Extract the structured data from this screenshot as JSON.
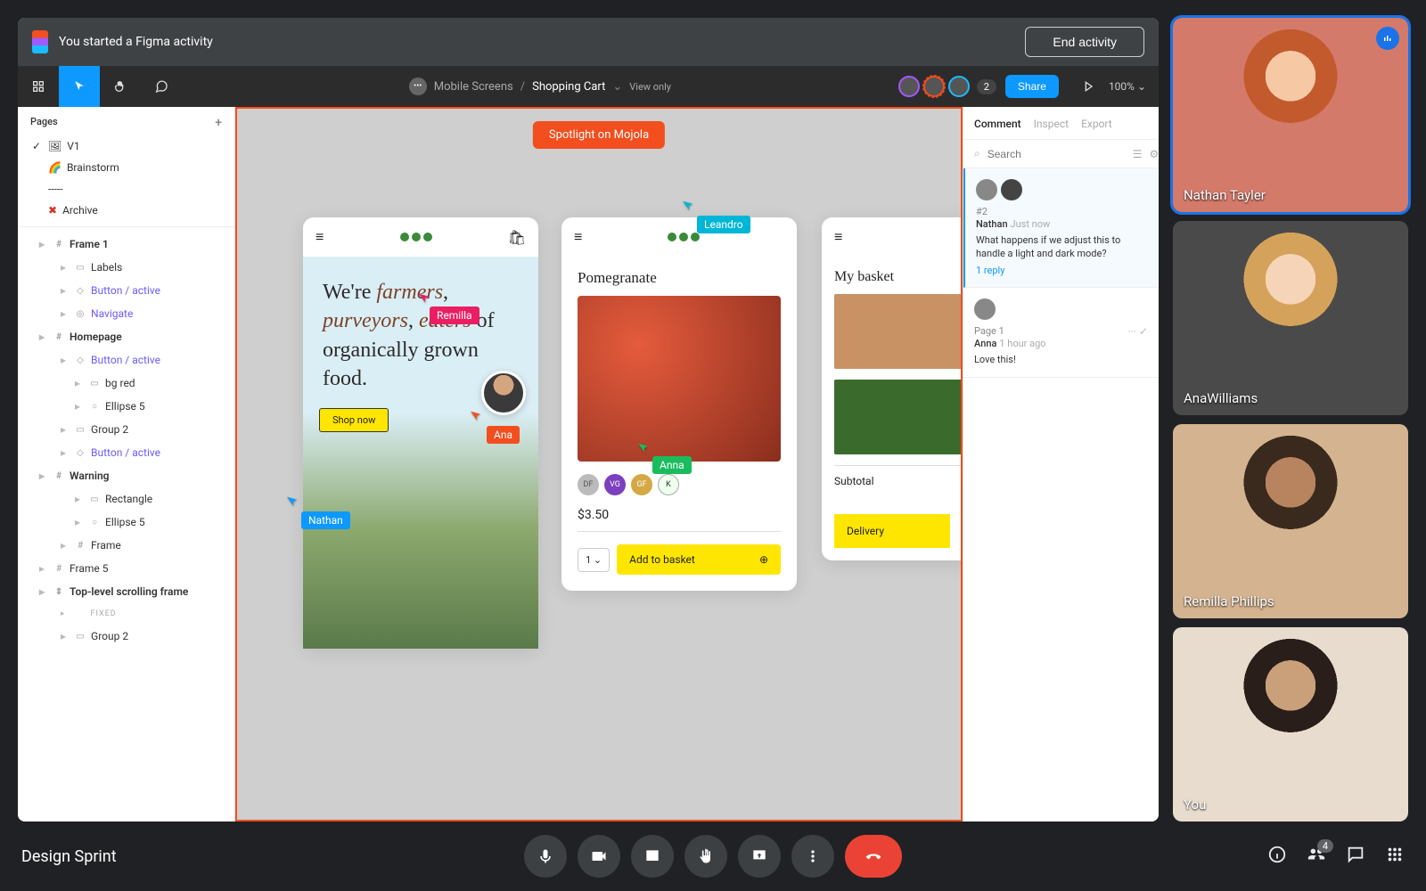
{
  "activity": {
    "title": "You started a Figma activity",
    "endLabel": "End activity"
  },
  "header": {
    "project": "Mobile Screens",
    "page": "Shopping Cart",
    "viewMode": "View only",
    "avatarCount": "2",
    "share": "Share",
    "zoom": "100%"
  },
  "pages": {
    "heading": "Pages",
    "items": [
      {
        "label": "V1",
        "prefix": "✓",
        "icon": "🖼"
      },
      {
        "label": "Brainstorm",
        "icon": "🌈"
      },
      {
        "label": "-----"
      },
      {
        "label": "Archive",
        "icon": "✖",
        "color": "#d93025"
      }
    ]
  },
  "layers": [
    {
      "label": "Frame 1",
      "level": 1,
      "icon": "#",
      "bold": true
    },
    {
      "label": "Labels",
      "level": 2,
      "icon": "▭"
    },
    {
      "label": "Button / active",
      "level": 2,
      "icon": "◇",
      "blue": true
    },
    {
      "label": "Navigate",
      "level": 2,
      "icon": "◎",
      "blue": true
    },
    {
      "label": "Homepage",
      "level": 1,
      "icon": "#",
      "bold": true
    },
    {
      "label": "Button / active",
      "level": 2,
      "icon": "◇",
      "blue": true
    },
    {
      "label": "bg red",
      "level": 3,
      "icon": "▭"
    },
    {
      "label": "Ellipse 5",
      "level": 3,
      "icon": "○"
    },
    {
      "label": "Group 2",
      "level": 2,
      "icon": "▭"
    },
    {
      "label": "Button / active",
      "level": 2,
      "icon": "◇",
      "blue": true
    },
    {
      "label": "Warning",
      "level": 1,
      "icon": "#",
      "bold": true
    },
    {
      "label": "Rectangle",
      "level": 3,
      "icon": "▭"
    },
    {
      "label": "Ellipse 5",
      "level": 3,
      "icon": "○"
    },
    {
      "label": "Frame",
      "level": 2,
      "icon": "#"
    },
    {
      "label": "Frame 5",
      "level": 1,
      "icon": "#"
    },
    {
      "label": "Top-level scrolling frame",
      "level": 1,
      "icon": "⇕",
      "bold": true
    },
    {
      "label": "FIXED",
      "level": 2,
      "gray": true
    },
    {
      "label": "Group 2",
      "level": 2,
      "icon": "▭"
    }
  ],
  "canvas": {
    "spotlight": "Spotlight on Mojola",
    "mock1": {
      "heroHtml": "We're <i>farmers</i>, <i>purveyors</i>, <i>eaters</i> of organically grown food.",
      "cta": "Shop now"
    },
    "mock2": {
      "title": "Pomegranate",
      "chips": [
        "DF",
        "VG",
        "GF",
        "K"
      ],
      "price": "$3.50",
      "qty": "1",
      "add": "Add to basket"
    },
    "mock3": {
      "title": "My basket",
      "subtotal": "Subtotal",
      "delivery": "Delivery"
    },
    "cursors": {
      "remilla": "Remilla",
      "ana": "Ana",
      "nathan": "Nathan",
      "leandro": "Leandro",
      "anna": "Anna"
    }
  },
  "comments": {
    "tabs": [
      "Comment",
      "Inspect",
      "Export"
    ],
    "searchPlaceholder": "Search",
    "threads": [
      {
        "num": "#2",
        "name": "Nathan",
        "time": "Just now",
        "text": "What happens if we adjust this to handle a light and dark mode?",
        "reply": "1 reply"
      },
      {
        "num": "Page 1",
        "name": "Anna",
        "time": "1 hour ago",
        "text": "Love this!"
      }
    ]
  },
  "video": {
    "tiles": [
      {
        "name": "Nathan Tayler",
        "speaking": true
      },
      {
        "name": "AnaWilliams"
      },
      {
        "name": "Remilla Phillips"
      },
      {
        "name": "You"
      }
    ]
  },
  "meet": {
    "name": "Design Sprint",
    "peopleBadge": "4"
  }
}
